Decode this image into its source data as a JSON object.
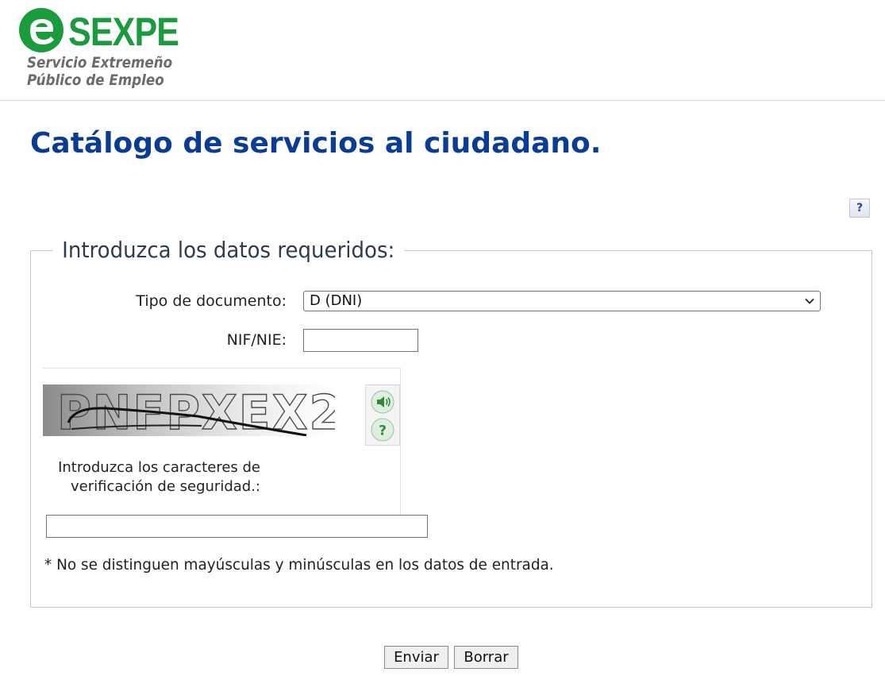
{
  "header": {
    "logo_text": "SEXPE",
    "logo_subtitle_line1": "Servicio Extremeño",
    "logo_subtitle_line2": "Público de Empleo",
    "brand_color": "#1a9b3e"
  },
  "page": {
    "title": "Catálogo de servicios al ciudadano.",
    "title_color": "#0b3c94",
    "help_label": "?"
  },
  "form": {
    "legend": "Introduzca los datos requeridos:",
    "doc_type_label": "Tipo de documento:",
    "doc_type_value": "D (DNI)",
    "nif_label": "NIF/NIE:",
    "nif_value": "",
    "captcha_text": "PNFPXEX2",
    "captcha_audio_icon": "speaker-icon",
    "captcha_help_icon": "question-icon",
    "captcha_label": "Introduzca los caracteres de verificación de seguridad.:",
    "captcha_value": "",
    "note": "* No se distinguen mayúsculas y minúsculas en los datos de entrada."
  },
  "buttons": {
    "send": "Enviar",
    "clear": "Borrar"
  }
}
